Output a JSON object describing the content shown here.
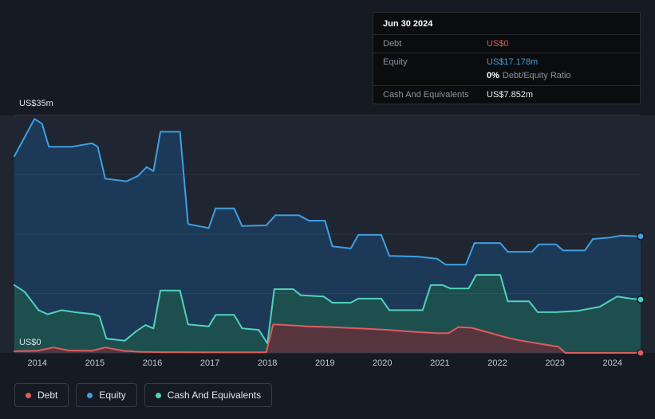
{
  "tooltip": {
    "date": "Jun 30 2024",
    "debt_label": "Debt",
    "debt_value": "US$0",
    "equity_label": "Equity",
    "equity_value": "US$17.178m",
    "ratio_value": "0%",
    "ratio_label": "Debt/Equity Ratio",
    "cash_label": "Cash And Equivalents",
    "cash_value": "US$7.852m"
  },
  "legend": [
    "Debt",
    "Equity",
    "Cash And Equivalents"
  ],
  "chart_data": {
    "type": "area",
    "title": "",
    "y_axis_max_label": "US$35m",
    "y_axis_min_label": "US$0",
    "y_max": 35,
    "y_min": 0,
    "x_domain": [
      2013.6,
      2024.49
    ],
    "x_ticks": [
      "2014",
      "2015",
      "2016",
      "2017",
      "2018",
      "2019",
      "2020",
      "2021",
      "2022",
      "2023",
      "2024"
    ],
    "grid_fractions": [
      0,
      0.25,
      0.5,
      0.75,
      1
    ],
    "legend_position": "bottom-left",
    "series": [
      {
        "name": "Equity",
        "color": "#3f9fe0",
        "fill": "#1c3a58",
        "end_value": 17.178,
        "points": [
          [
            2013.6,
            29.0
          ],
          [
            2013.95,
            34.5
          ],
          [
            2014.08,
            33.8
          ],
          [
            2014.2,
            30.4
          ],
          [
            2014.6,
            30.4
          ],
          [
            2014.95,
            30.9
          ],
          [
            2015.05,
            30.4
          ],
          [
            2015.18,
            25.7
          ],
          [
            2015.55,
            25.3
          ],
          [
            2015.75,
            26.1
          ],
          [
            2015.9,
            27.4
          ],
          [
            2016.02,
            26.8
          ],
          [
            2016.14,
            32.6
          ],
          [
            2016.48,
            32.6
          ],
          [
            2016.62,
            19.0
          ],
          [
            2016.98,
            18.4
          ],
          [
            2017.1,
            21.3
          ],
          [
            2017.42,
            21.3
          ],
          [
            2017.56,
            18.7
          ],
          [
            2017.98,
            18.8
          ],
          [
            2018.14,
            20.3
          ],
          [
            2018.55,
            20.3
          ],
          [
            2018.72,
            19.5
          ],
          [
            2019.0,
            19.5
          ],
          [
            2019.13,
            15.7
          ],
          [
            2019.45,
            15.4
          ],
          [
            2019.58,
            17.4
          ],
          [
            2019.98,
            17.4
          ],
          [
            2020.12,
            14.3
          ],
          [
            2020.6,
            14.2
          ],
          [
            2020.95,
            13.9
          ],
          [
            2021.1,
            13.0
          ],
          [
            2021.45,
            13.0
          ],
          [
            2021.6,
            16.2
          ],
          [
            2022.05,
            16.2
          ],
          [
            2022.18,
            14.9
          ],
          [
            2022.6,
            14.9
          ],
          [
            2022.72,
            16.0
          ],
          [
            2023.02,
            16.0
          ],
          [
            2023.14,
            15.1
          ],
          [
            2023.52,
            15.1
          ],
          [
            2023.66,
            16.8
          ],
          [
            2023.95,
            17.0
          ],
          [
            2024.15,
            17.3
          ],
          [
            2024.49,
            17.178
          ]
        ]
      },
      {
        "name": "Cash And Equivalents",
        "color": "#50d2bb",
        "fill": "#1d4f4e",
        "end_value": 7.852,
        "points": [
          [
            2013.6,
            10.0
          ],
          [
            2013.78,
            9.0
          ],
          [
            2014.02,
            6.3
          ],
          [
            2014.18,
            5.7
          ],
          [
            2014.42,
            6.3
          ],
          [
            2014.65,
            6.0
          ],
          [
            2014.98,
            5.7
          ],
          [
            2015.08,
            5.4
          ],
          [
            2015.2,
            2.1
          ],
          [
            2015.52,
            1.8
          ],
          [
            2015.72,
            3.2
          ],
          [
            2015.88,
            4.1
          ],
          [
            2016.02,
            3.6
          ],
          [
            2016.14,
            9.2
          ],
          [
            2016.48,
            9.2
          ],
          [
            2016.62,
            4.2
          ],
          [
            2016.98,
            3.9
          ],
          [
            2017.1,
            5.6
          ],
          [
            2017.42,
            5.6
          ],
          [
            2017.56,
            3.6
          ],
          [
            2017.85,
            3.4
          ],
          [
            2018.0,
            1.4
          ],
          [
            2018.12,
            9.4
          ],
          [
            2018.45,
            9.4
          ],
          [
            2018.58,
            8.5
          ],
          [
            2018.98,
            8.3
          ],
          [
            2019.13,
            7.4
          ],
          [
            2019.45,
            7.4
          ],
          [
            2019.58,
            8.0
          ],
          [
            2019.98,
            8.0
          ],
          [
            2020.12,
            6.3
          ],
          [
            2020.7,
            6.3
          ],
          [
            2020.84,
            10.0
          ],
          [
            2021.05,
            10.0
          ],
          [
            2021.18,
            9.5
          ],
          [
            2021.5,
            9.5
          ],
          [
            2021.63,
            11.5
          ],
          [
            2022.05,
            11.5
          ],
          [
            2022.18,
            7.6
          ],
          [
            2022.55,
            7.6
          ],
          [
            2022.7,
            6.0
          ],
          [
            2023.02,
            6.0
          ],
          [
            2023.4,
            6.2
          ],
          [
            2023.78,
            6.8
          ],
          [
            2024.08,
            8.3
          ],
          [
            2024.32,
            8.0
          ],
          [
            2024.49,
            7.852
          ]
        ]
      },
      {
        "name": "Debt",
        "color": "#df5c5c",
        "fill": "#57353f",
        "end_value": 0,
        "points": [
          [
            2013.6,
            0.25
          ],
          [
            2014.0,
            0.3
          ],
          [
            2014.28,
            0.8
          ],
          [
            2014.55,
            0.35
          ],
          [
            2014.95,
            0.3
          ],
          [
            2015.18,
            0.8
          ],
          [
            2015.5,
            0.3
          ],
          [
            2015.8,
            0.15
          ],
          [
            2016.2,
            0.1
          ],
          [
            2017.5,
            0.08
          ],
          [
            2017.98,
            0.08
          ],
          [
            2018.1,
            4.2
          ],
          [
            2018.35,
            4.1
          ],
          [
            2018.7,
            3.9
          ],
          [
            2019.1,
            3.8
          ],
          [
            2019.6,
            3.6
          ],
          [
            2020.1,
            3.4
          ],
          [
            2020.55,
            3.1
          ],
          [
            2020.95,
            2.9
          ],
          [
            2021.15,
            2.9
          ],
          [
            2021.32,
            3.8
          ],
          [
            2021.55,
            3.7
          ],
          [
            2021.85,
            3.0
          ],
          [
            2022.1,
            2.4
          ],
          [
            2022.35,
            1.9
          ],
          [
            2022.62,
            1.5
          ],
          [
            2022.92,
            1.1
          ],
          [
            2023.06,
            0.9
          ],
          [
            2023.18,
            0.0
          ],
          [
            2024.49,
            0.0
          ]
        ]
      }
    ]
  },
  "colors": {
    "debt": "#df5c5c",
    "equity": "#3f9fe0",
    "cash": "#50d2bb"
  }
}
